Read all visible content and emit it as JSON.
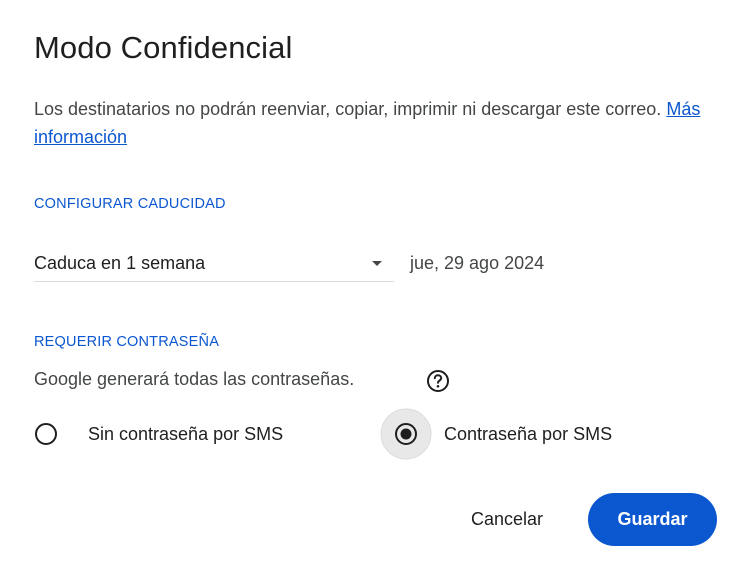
{
  "dialog": {
    "title": "Modo Confidencial",
    "description": "Los destinatarios no podrán reenviar, copiar, imprimir ni descargar este correo.",
    "learn_more": "Más información"
  },
  "expiry": {
    "section_label": "CONFIGURAR CADUCIDAD",
    "selected_option": "Caduca en 1 semana",
    "date": "jue, 29 ago 2024",
    "dropdown_icon": "arrow-drop-down-icon"
  },
  "password": {
    "section_label": "REQUERIR CONTRASEÑA",
    "hint": "Google generará todas las contraseñas.",
    "help_icon": "help-circle-icon",
    "options": [
      {
        "label": "Sin contraseña por SMS",
        "selected": false
      },
      {
        "label": "Contraseña por SMS",
        "selected": true
      }
    ]
  },
  "actions": {
    "cancel_label": "Cancelar",
    "save_label": "Guardar"
  },
  "colors": {
    "accent": "#0b57d0",
    "text_primary": "#1f1f1f",
    "text_secondary": "#444746",
    "divider": "#dadce0",
    "radio_hover_bg": "#e8e8e8"
  }
}
